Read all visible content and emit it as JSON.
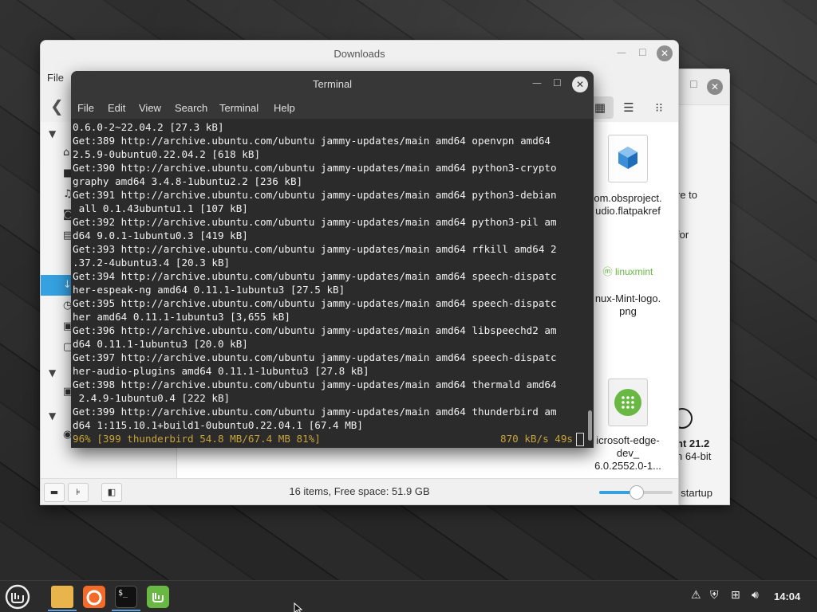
{
  "downloads_window": {
    "title": "Downloads",
    "menu_file": "File",
    "status": "16 items, Free space: 51.9 GB",
    "zoom_level": 0.5,
    "files": [
      {
        "name": "com.obsproject.Studio.flatpakref",
        "visible_label": "om.obsproject.\nudio.flatpakref"
      },
      {
        "name": "Linux-Mint-logo.png",
        "visible_label": "nux-Mint-logo.\npng",
        "logo_text": "linuxmint"
      },
      {
        "name": "microsoft-edge-dev_",
        "visible_label": "icrosoft-edge-\ndev_\n6.0.2552.0-1..."
      }
    ]
  },
  "back_window": {
    "fragments": [
      "re to",
      "for",
      "nt 21.2",
      "n 64-bit",
      "t startup"
    ]
  },
  "terminal": {
    "title": "Terminal",
    "menu": [
      "File",
      "Edit",
      "View",
      "Search",
      "Terminal",
      "Help"
    ],
    "lines": [
      "0.6.0-2~22.04.2 [27.3 kB]",
      "Get:389 http://archive.ubuntu.com/ubuntu jammy-updates/main amd64 openvpn amd64",
      "2.5.9-0ubuntu0.22.04.2 [618 kB]",
      "Get:390 http://archive.ubuntu.com/ubuntu jammy-updates/main amd64 python3-crypto",
      "graphy amd64 3.4.8-1ubuntu2.2 [236 kB]",
      "Get:391 http://archive.ubuntu.com/ubuntu jammy-updates/main amd64 python3-debian",
      " all 0.1.43ubuntu1.1 [107 kB]",
      "Get:392 http://archive.ubuntu.com/ubuntu jammy-updates/main amd64 python3-pil am",
      "d64 9.0.1-1ubuntu0.3 [419 kB]",
      "Get:393 http://archive.ubuntu.com/ubuntu jammy-updates/main amd64 rfkill amd64 2",
      ".37.2-4ubuntu3.4 [20.3 kB]",
      "Get:394 http://archive.ubuntu.com/ubuntu jammy-updates/main amd64 speech-dispatc",
      "her-espeak-ng amd64 0.11.1-1ubuntu3 [27.5 kB]",
      "Get:395 http://archive.ubuntu.com/ubuntu jammy-updates/main amd64 speech-dispatc",
      "her amd64 0.11.1-1ubuntu3 [3,655 kB]",
      "Get:396 http://archive.ubuntu.com/ubuntu jammy-updates/main amd64 libspeechd2 am",
      "d64 0.11.1-1ubuntu3 [20.0 kB]",
      "Get:397 http://archive.ubuntu.com/ubuntu jammy-updates/main amd64 speech-dispatc",
      "her-audio-plugins amd64 0.11.1-1ubuntu3 [27.8 kB]",
      "Get:398 http://archive.ubuntu.com/ubuntu jammy-updates/main amd64 thermald amd64",
      " 2.4.9-1ubuntu0.4 [222 kB]",
      "Get:399 http://archive.ubuntu.com/ubuntu jammy-updates/main amd64 thunderbird am",
      "d64 1:115.10.1+build1-0ubuntu0.22.04.1 [67.4 MB]"
    ],
    "progress_left": "96% [399 thunderbird 54.8 MB/67.4 MB 81%]",
    "progress_right": "870 kB/s 49s"
  },
  "taskbar": {
    "clock": "14:04",
    "apps": [
      "menu-icon",
      "files-icon",
      "firefox-icon",
      "terminal-icon",
      "mintinstall-icon"
    ],
    "terminal_glyph": "$_"
  },
  "colors": {
    "accent": "#35a1e0",
    "terminal_bg": "#2b2b2b",
    "progress_text": "#c7a33a",
    "mint_green": "#6ab844"
  }
}
